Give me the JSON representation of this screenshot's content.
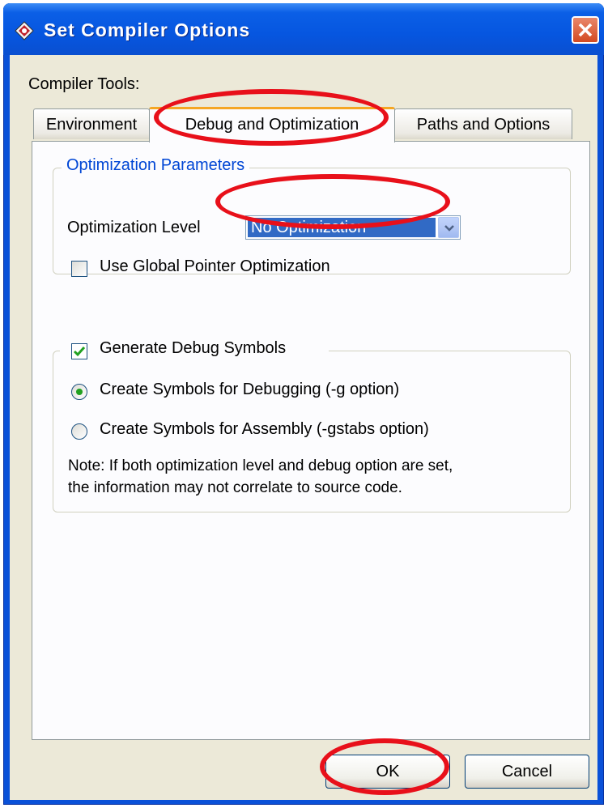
{
  "window": {
    "title": "Set Compiler Options"
  },
  "compiler_tools_label": "Compiler Tools:",
  "tabs": [
    {
      "label": "Environment",
      "active": false
    },
    {
      "label": "Debug and Optimization",
      "active": true
    },
    {
      "label": "Paths and Options",
      "active": false
    }
  ],
  "optimization": {
    "group_title": "Optimization Parameters",
    "level_label": "Optimization Level",
    "level_value": "No Optimization",
    "global_pointer_label": "Use Global Pointer Optimization",
    "global_pointer_checked": false
  },
  "debug": {
    "generate_label": "Generate Debug Symbols",
    "generate_checked": true,
    "options": [
      {
        "label": "Create Symbols for Debugging (-g option)",
        "selected": true
      },
      {
        "label": "Create Symbols for Assembly (-gstabs option)",
        "selected": false
      }
    ],
    "note_line1": "Note: If both optimization level and debug option are set,",
    "note_line2": "the information may not correlate to source code."
  },
  "buttons": {
    "ok": "OK",
    "cancel": "Cancel"
  },
  "colors": {
    "titlebar": "#0656e0",
    "accent_blue": "#316ac5",
    "annotation_red": "#e8101a",
    "group_title": "#0046d5"
  },
  "icons": {
    "app": "compiler-app-icon",
    "close": "close-icon",
    "dropdown": "chevron-down-icon"
  }
}
